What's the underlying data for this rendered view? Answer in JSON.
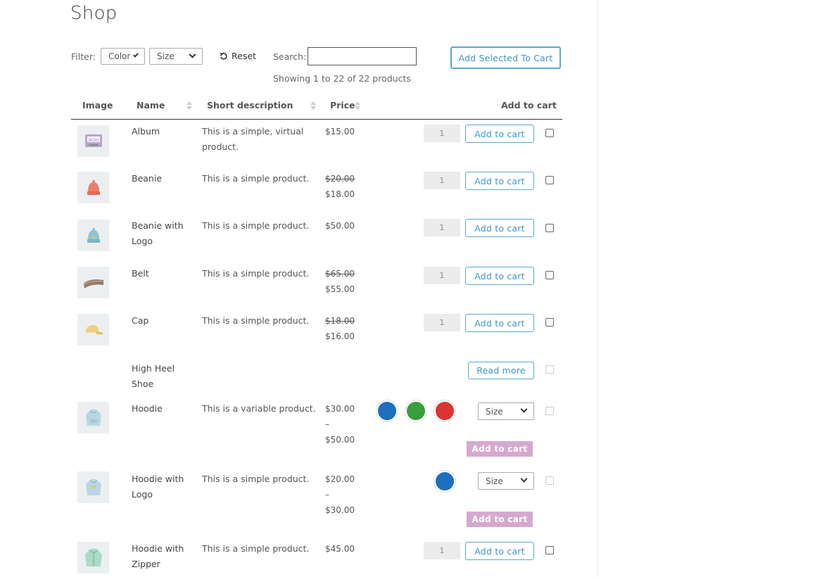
{
  "page": {
    "title": "Shop"
  },
  "toolbar": {
    "filter_label": "Filter:",
    "color_select": "Color",
    "size_select": "Size",
    "reset_label": "Reset",
    "search_label": "Search:",
    "search_value": "",
    "add_selected_label": "Add Selected To Cart"
  },
  "showing": "Showing 1 to 22 of 22 products",
  "table": {
    "headers": {
      "image": "Image",
      "name": "Name",
      "description": "Short description",
      "price": "Price",
      "add_to_cart": "Add to cart"
    }
  },
  "colors": {
    "accent": "#3f97c8",
    "disabled_button": "#d5a9cf",
    "swatch_blue": "#1e6fbd",
    "swatch_green": "#3a9e3a",
    "swatch_red": "#dd3333"
  },
  "products": [
    {
      "name_line1": "Album",
      "name_line2": "",
      "desc_line1": "This is a simple, virtual",
      "desc_line2": "product.",
      "price_old": "",
      "price": "$15.00",
      "qty": "1",
      "button": "Add to cart",
      "icon": "album-icon"
    },
    {
      "name_line1": "Beanie",
      "name_line2": "",
      "desc_line1": "This is a simple product.",
      "desc_line2": "",
      "price_old": "$20.00",
      "price": "$18.00",
      "qty": "1",
      "button": "Add to cart",
      "icon": "beanie-icon"
    },
    {
      "name_line1": "Beanie with",
      "name_line2": "Logo",
      "desc_line1": "This is a simple product.",
      "desc_line2": "",
      "price_old": "",
      "price": "$50.00",
      "qty": "1",
      "button": "Add to cart",
      "icon": "beanie-logo-icon"
    },
    {
      "name_line1": "Belt",
      "name_line2": "",
      "desc_line1": "This is a simple product.",
      "desc_line2": "",
      "price_old": "$65.00",
      "price": "$55.00",
      "qty": "1",
      "button": "Add to cart",
      "icon": "belt-icon"
    },
    {
      "name_line1": "Cap",
      "name_line2": "",
      "desc_line1": "This is a simple product.",
      "desc_line2": "",
      "price_old": "$18.00",
      "price": "$16.00",
      "qty": "1",
      "button": "Add to cart",
      "icon": "cap-icon"
    },
    {
      "name_line1": "High Heel",
      "name_line2": "Shoe",
      "desc_line1": "",
      "desc_line2": "",
      "price_old": "",
      "price": "",
      "qty": "",
      "button": "Read more",
      "icon": ""
    },
    {
      "name_line1": "Hoodie",
      "name_line2": "",
      "desc_line1": "This is a variable product.",
      "desc_line2": "",
      "price_from": "$30.00",
      "price_dash": "–",
      "price_to": "$50.00",
      "size_select": "Size",
      "button": "Add to cart",
      "icon": "hoodie-icon"
    },
    {
      "name_line1": "Hoodie with",
      "name_line2": "Logo",
      "desc_line1": "This is a simple product.",
      "desc_line2": "",
      "price_from": "$20.00",
      "price_dash": "–",
      "price_to": "$30.00",
      "size_select": "Size",
      "button": "Add to cart",
      "icon": "hoodie-logo-icon"
    },
    {
      "name_line1": "Hoodie with",
      "name_line2": "Zipper",
      "desc_line1": "This is a simple product.",
      "desc_line2": "",
      "price_old": "",
      "price": "$45.00",
      "qty": "1",
      "button": "Add to cart",
      "icon": "hoodie-zipper-icon"
    }
  ]
}
